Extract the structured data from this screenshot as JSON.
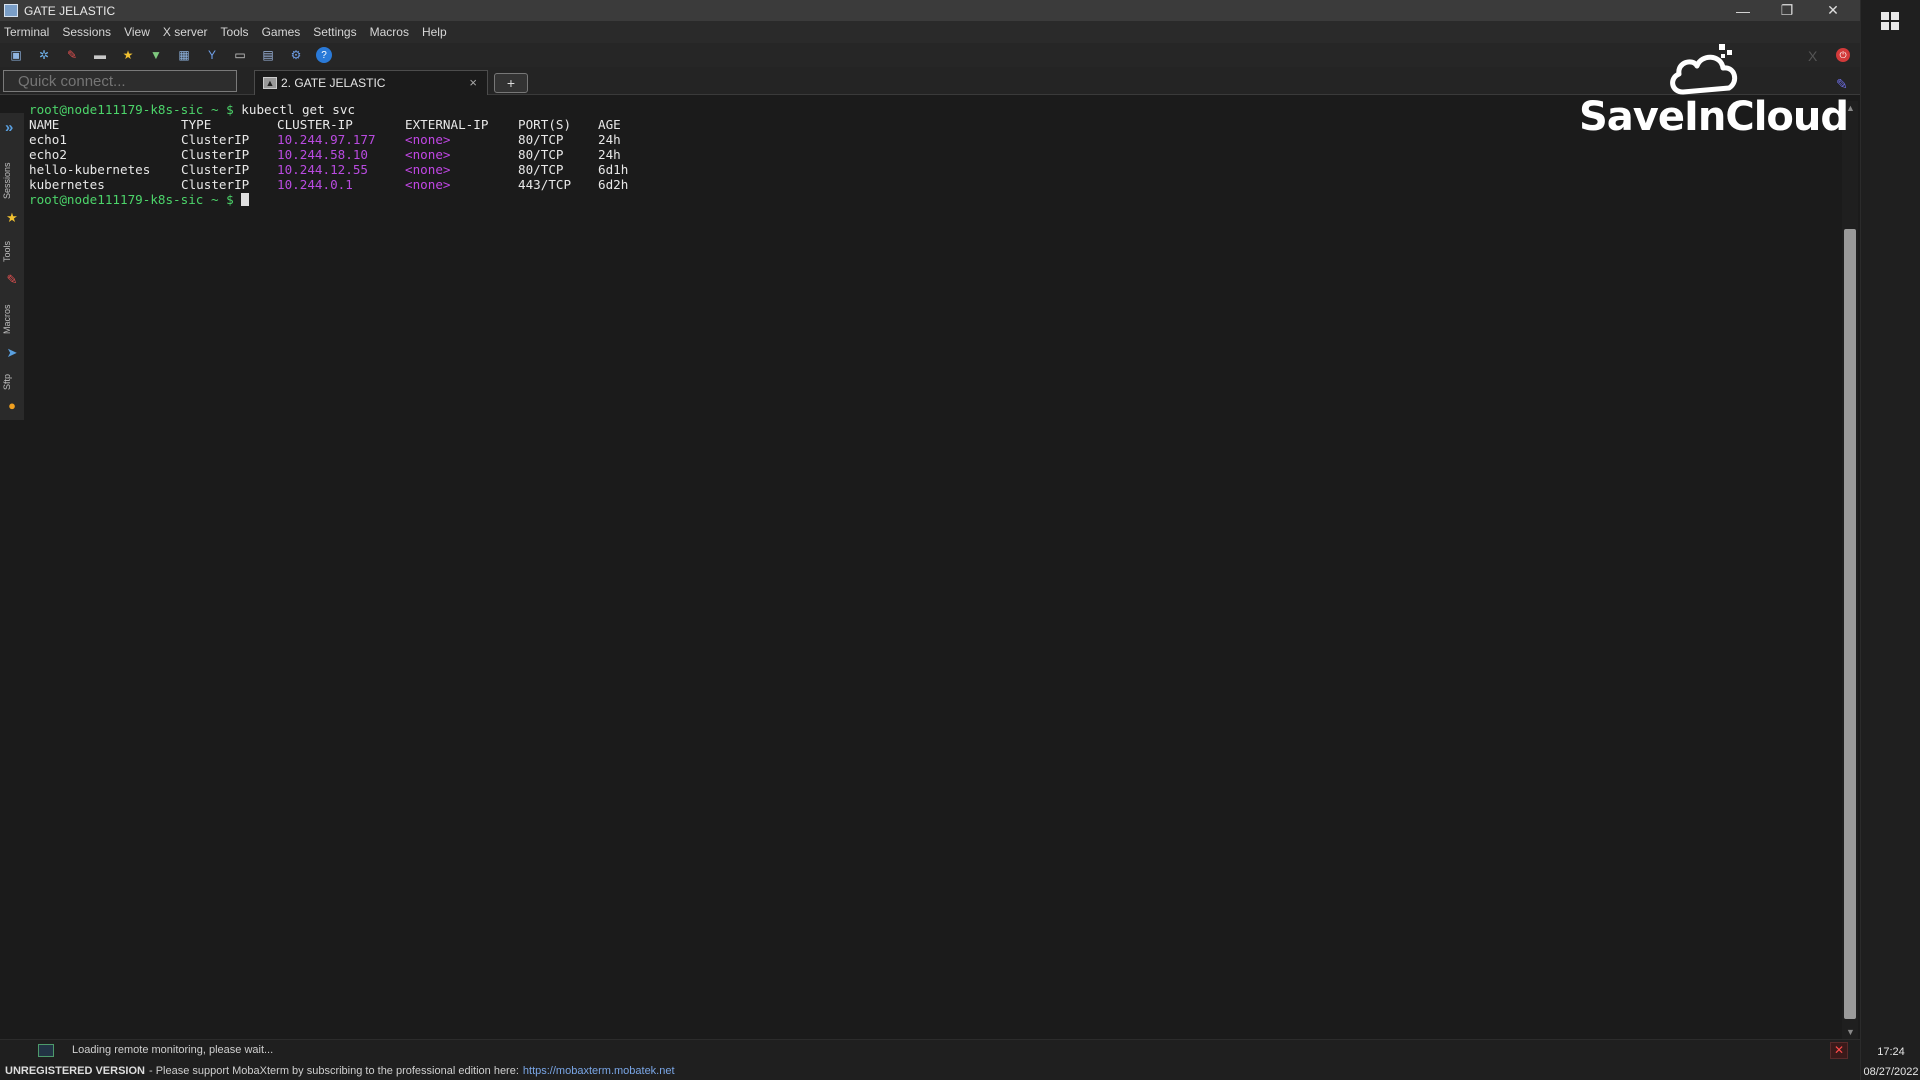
{
  "window": {
    "title": "GATE JELASTIC",
    "min_glyph": "—",
    "max_glyph": "❐",
    "close_glyph": "✕"
  },
  "menu": [
    "Terminal",
    "Sessions",
    "View",
    "X server",
    "Tools",
    "Games",
    "Settings",
    "Macros",
    "Help"
  ],
  "toolbar_icons": [
    "session-icon",
    "servers-icon",
    "tools-icon",
    "games-icon",
    "favorites-icon",
    "view-icon",
    "split-icon",
    "multiexec-icon",
    "tunneling-icon",
    "packages-icon",
    "settings-icon",
    "help-icon"
  ],
  "quick_connect": {
    "placeholder": "Quick connect..."
  },
  "tab": {
    "label": "2. GATE JELASTIC",
    "close": "×"
  },
  "new_tab": "+",
  "sidebar_tabs": [
    "Sessions",
    "Tools",
    "Macros",
    "Sftp"
  ],
  "terminal": {
    "prompt": "root@node111179-k8s-sic ~ $",
    "command": " kubectl get svc",
    "headers": [
      "NAME",
      "TYPE",
      "CLUSTER-IP",
      "EXTERNAL-IP",
      "PORT(S)",
      "AGE"
    ],
    "rows": [
      {
        "name": "echo1",
        "type": "ClusterIP",
        "ip": "10.244.97.177",
        "ext": "<none>",
        "port": "80/TCP",
        "age": "24h"
      },
      {
        "name": "echo2",
        "type": "ClusterIP",
        "ip": "10.244.58.10",
        "ext": "<none>",
        "port": "80/TCP",
        "age": "24h"
      },
      {
        "name": "hello-kubernetes",
        "type": "ClusterIP",
        "ip": "10.244.12.55",
        "ext": "<none>",
        "port": "80/TCP",
        "age": "6d1h"
      },
      {
        "name": "kubernetes",
        "type": "ClusterIP",
        "ip": "10.244.0.1",
        "ext": "<none>",
        "port": "443/TCP",
        "age": "6d2h"
      }
    ]
  },
  "watermark": {
    "text": "SaveInCloud"
  },
  "status": {
    "monitoring": "Loading remote monitoring, please wait..."
  },
  "bottom": {
    "unregistered": "UNREGISTERED VERSION",
    "support": "-  Please support MobaXterm by subscribing to the professional edition here:",
    "link": "https://mobaxterm.mobatek.net"
  },
  "taskbar": {
    "time": "17:24",
    "date": "08/27/2022"
  },
  "colors": {
    "prompt": "#4cd46a",
    "ip": "#b94be0",
    "accent": "#5aa0e0"
  }
}
